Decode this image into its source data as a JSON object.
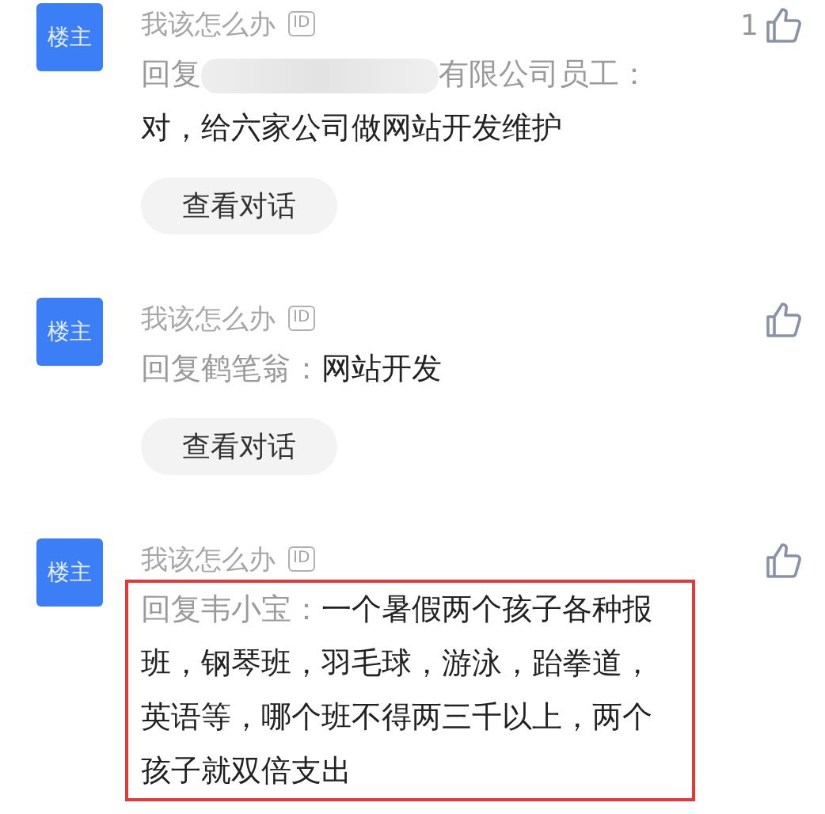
{
  "comments": [
    {
      "badge": "楼主",
      "author": "我该怎么办",
      "id_tag": "ID",
      "likes": "1",
      "reply_prefix": "回复",
      "reply_to_blurred": true,
      "reply_to": "有限公司员工：",
      "content": "对，给六家公司做网站开发维护",
      "button": "查看对话",
      "highlighted": false
    },
    {
      "badge": "楼主",
      "author": "我该怎么办",
      "id_tag": "ID",
      "reply_prefix": "回复",
      "reply_to_blurred": false,
      "reply_to": "鹤笔翁：",
      "content": "网站开发",
      "button": "查看对话",
      "highlighted": false
    },
    {
      "badge": "楼主",
      "author": "我该怎么办",
      "id_tag": "ID",
      "reply_prefix": "回复",
      "reply_to_blurred": false,
      "reply_to": "韦小宝：",
      "content": "一个暑假两个孩子各种报班，钢琴班，羽毛球，游泳，跆拳道，英语等，哪个班不得两三千以上，两个孩子就双倍支出",
      "highlighted": true
    }
  ]
}
